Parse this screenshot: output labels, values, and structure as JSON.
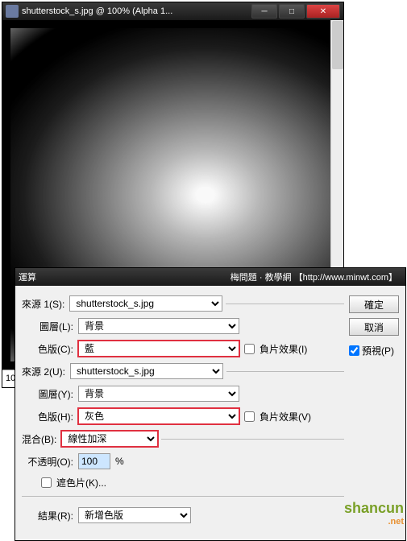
{
  "image_window": {
    "title": "shutterstock_s.jpg @ 100% (Alpha 1...",
    "zoom": "100%"
  },
  "dialog": {
    "title": "運算",
    "subtitle": "梅問題 · 教學網  【http://www.minwt.com】",
    "source1": {
      "label": "來源 1(S):",
      "file": "shutterstock_s.jpg",
      "layer_label": "圖層(L):",
      "layer": "背景",
      "channel_label": "色版(C):",
      "channel": "藍",
      "invert_label": "負片效果(I)",
      "invert": false
    },
    "source2": {
      "label": "來源 2(U):",
      "file": "shutterstock_s.jpg",
      "layer_label": "圖層(Y):",
      "layer": "背景",
      "channel_label": "色版(H):",
      "channel": "灰色",
      "invert_label": "負片效果(V)",
      "invert": false
    },
    "blend": {
      "label": "混合(B):",
      "mode": "線性加深",
      "opacity_label": "不透明(O):",
      "opacity": "100",
      "opacity_suffix": "%",
      "mask_label": "遮色片(K)...",
      "mask": false
    },
    "result": {
      "label": "結果(R):",
      "value": "新增色版"
    },
    "buttons": {
      "ok": "確定",
      "cancel": "取消",
      "preview_label": "預視(P)",
      "preview": true
    }
  },
  "watermark": {
    "main": "shancun",
    "sub": ".net"
  }
}
